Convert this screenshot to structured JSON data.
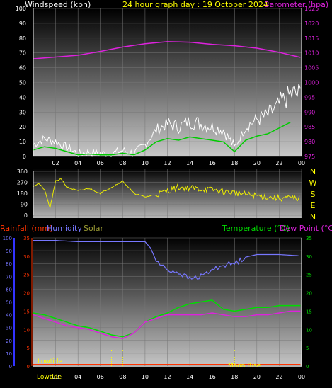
{
  "panel1": {
    "left_title": "Windspeed (kph)",
    "center_title": "24 hour graph day : 19 October 2024",
    "right_title": "Barometer (hpa)"
  },
  "panel2": {
    "compass_labels": [
      "N",
      "W",
      "S",
      "E",
      "N"
    ]
  },
  "panel3": {
    "rainfall_label": "Rainfall (mm)",
    "humidity_label": "Humidity",
    "solar_label": "Solar",
    "temperature_label": "Temperature (°C)",
    "dewpoint_label": "Dew Point (°C)",
    "lowtide_label": "Lowtide",
    "lowtide_bottom_label": "Lowtide",
    "moonrise_label": "Moon Rise"
  },
  "colors": {
    "windspeed": "#ffffff",
    "gust": "#ffffff",
    "wind_avg": "#00cc00",
    "barometer": "#dd22dd",
    "direction": "#eeee00",
    "rainfall": "#ff3300",
    "humidity": "#7777ff",
    "solar": "#999933",
    "temperature": "#00dd00",
    "dewpoint": "#dd22dd"
  },
  "chart_data": [
    {
      "type": "line",
      "x_ticks": [
        "02",
        "04",
        "06",
        "08",
        "10",
        "12",
        "14",
        "16",
        "18",
        "20",
        "22",
        "00"
      ],
      "y_left_ticks": [
        "0",
        "10",
        "20",
        "30",
        "40",
        "50",
        "60",
        "70",
        "80",
        "90",
        "100"
      ],
      "y_left_lim": [
        0,
        100
      ],
      "y_right_ticks": [
        "975",
        "980",
        "985",
        "990",
        "995",
        "1000",
        "1005",
        "1010",
        "1015",
        "1020",
        "1025"
      ],
      "y_right_lim": [
        975,
        1025
      ],
      "grid": true,
      "series": [
        {
          "name": "Windspeed (kph)",
          "axis": "left",
          "x": [
            0,
            1,
            2,
            3,
            4,
            5,
            6,
            7,
            8,
            9,
            10,
            11,
            12,
            13,
            14,
            15,
            16,
            17,
            18,
            19,
            20,
            21,
            22,
            23
          ],
          "values": [
            8,
            12,
            10,
            6,
            2,
            3,
            2,
            2,
            4,
            2,
            8,
            18,
            22,
            20,
            24,
            22,
            20,
            18,
            6,
            20,
            25,
            28,
            35,
            42
          ]
        },
        {
          "name": "Barometer (hpa)",
          "axis": "right",
          "x": [
            0,
            2,
            4,
            6,
            8,
            10,
            12,
            14,
            16,
            18,
            20,
            22,
            23.9
          ],
          "values": [
            1008,
            1008.6,
            1009.2,
            1010.5,
            1012,
            1013.1,
            1013.8,
            1013.6,
            1012.9,
            1012.4,
            1011.6,
            1010.2,
            1008.5
          ]
        }
      ]
    },
    {
      "type": "line",
      "x_ticks": [
        "02",
        "04",
        "06",
        "08",
        "10",
        "12",
        "14",
        "16",
        "18",
        "20",
        "22",
        "00"
      ],
      "y_ticks": [
        "0",
        "90",
        "180",
        "270",
        "360"
      ],
      "y_lim": [
        0,
        360
      ],
      "series": [
        {
          "name": "Wind direction",
          "x": [
            0,
            0.5,
            1,
            1.5,
            2,
            2.5,
            3,
            4,
            5,
            6,
            7,
            8,
            9,
            10,
            11,
            12,
            13,
            14,
            15,
            16,
            17,
            18,
            19,
            20,
            21,
            22,
            23,
            23.9
          ],
          "values": [
            240,
            260,
            210,
            60,
            280,
            300,
            230,
            200,
            220,
            180,
            230,
            280,
            180,
            150,
            170,
            200,
            230,
            225,
            215,
            210,
            195,
            185,
            170,
            160,
            150,
            140,
            140,
            135
          ]
        }
      ]
    },
    {
      "type": "line",
      "x_ticks": [
        "02",
        "04",
        "06",
        "08",
        "10",
        "12",
        "14",
        "16",
        "18",
        "20",
        "22",
        "00"
      ],
      "y_left_ticks": [
        "0",
        "10",
        "20",
        "30",
        "40",
        "50",
        "60",
        "70",
        "80",
        "90",
        "100"
      ],
      "y_left_lim": [
        0,
        100
      ],
      "y_rain_ticks": [
        "0",
        "5",
        "10",
        "15",
        "20",
        "25",
        "30",
        "35"
      ],
      "y_right_ticks": [
        "0",
        "5",
        "10",
        "15",
        "20",
        "25",
        "30",
        "35"
      ],
      "y_right_lim": [
        0,
        35
      ],
      "grid": true,
      "series": [
        {
          "name": "Humidity",
          "axis": "left",
          "x": [
            0,
            2,
            4,
            6,
            8,
            10,
            10.5,
            11,
            12,
            13,
            14,
            15,
            16,
            17,
            18,
            19,
            20,
            22,
            23.9
          ],
          "values": [
            98,
            98,
            97,
            97,
            97,
            97,
            92,
            82,
            75,
            73,
            68,
            70,
            75,
            79,
            80,
            85,
            87,
            87,
            86
          ]
        },
        {
          "name": "Temperature (°C)",
          "axis": "right",
          "x": [
            0,
            1,
            2,
            3,
            4,
            5,
            6,
            7,
            8,
            9,
            10,
            11,
            12,
            13,
            14,
            15,
            16,
            17,
            18,
            19,
            20,
            21,
            22,
            23,
            23.9
          ],
          "values": [
            14.5,
            14,
            13,
            12,
            11,
            10.5,
            9.5,
            8.5,
            8,
            9,
            12,
            13.5,
            14.5,
            16,
            17,
            17.5,
            18,
            15.5,
            15,
            15.5,
            16,
            16,
            16.5,
            16.5,
            16.5
          ]
        },
        {
          "name": "Dew Point (°C)",
          "axis": "right",
          "x": [
            0,
            1,
            2,
            3,
            4,
            5,
            6,
            7,
            8,
            9,
            10,
            11,
            12,
            13,
            14,
            15,
            16,
            17,
            18,
            19,
            20,
            21,
            22,
            23,
            23.9
          ],
          "values": [
            14,
            13,
            12,
            11,
            10.5,
            10,
            9,
            8,
            7.5,
            9,
            12,
            13,
            14,
            14,
            14,
            14,
            14.5,
            14,
            13.5,
            13.5,
            14,
            14,
            14.5,
            15,
            15
          ]
        },
        {
          "name": "Rainfall (mm)",
          "axis": "rain",
          "x": [
            0,
            23.9
          ],
          "values": [
            0,
            0
          ]
        }
      ]
    }
  ]
}
